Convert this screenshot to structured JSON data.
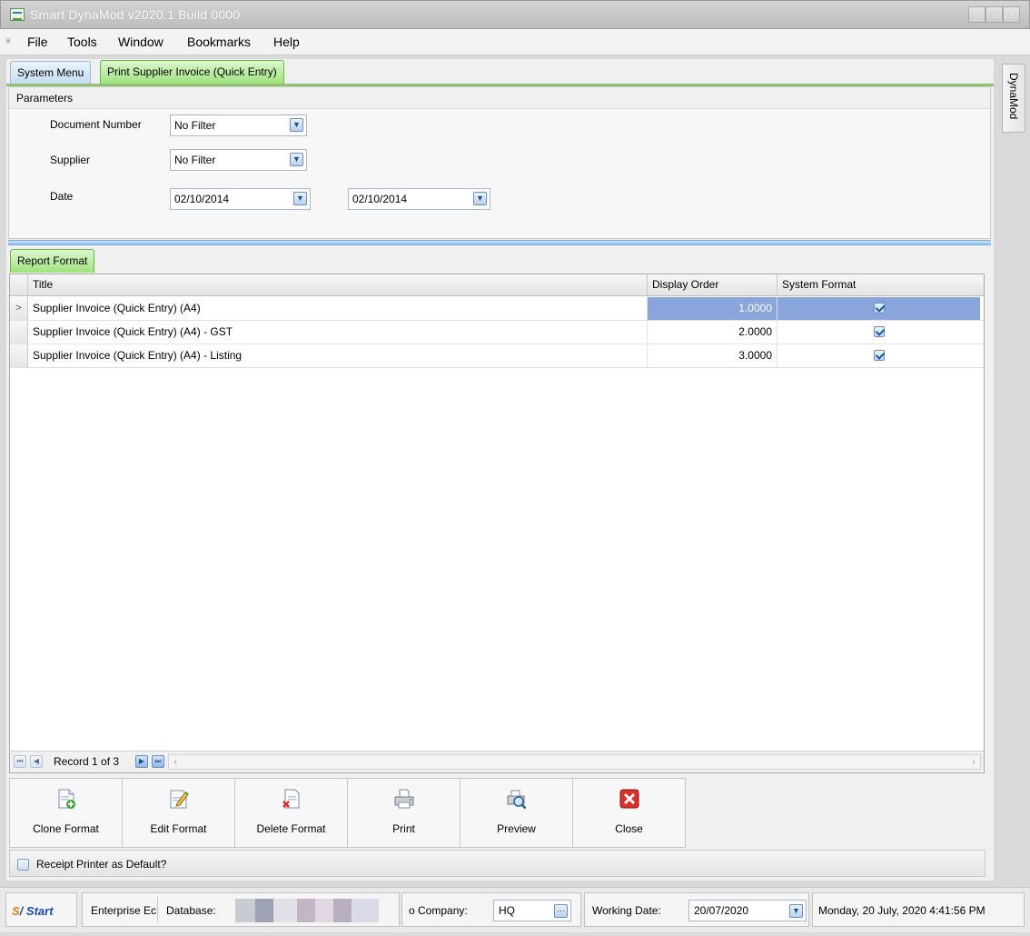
{
  "window": {
    "title": "Smart DynaMod v2020.1 Build 0000",
    "buttons": [
      "_",
      "□",
      "X"
    ]
  },
  "menu": [
    "File",
    "Tools",
    "Window",
    "Bookmarks",
    "Help"
  ],
  "tabs": {
    "system_menu": "System Menu",
    "active": "Print Supplier Invoice (Quick Entry)"
  },
  "parameters": {
    "header": "Parameters",
    "document_number": {
      "label": "Document Number",
      "value": "No Filter"
    },
    "supplier": {
      "label": "Supplier",
      "value": "No Filter"
    },
    "date": {
      "label": "Date",
      "from": "02/10/2014",
      "to": "02/10/2014"
    }
  },
  "report_tab": "Report Format",
  "grid": {
    "columns": [
      "Title",
      "Display Order",
      "System Format"
    ],
    "rows": [
      {
        "title": "Supplier Invoice (Quick Entry) (A4)",
        "order": "1.0000",
        "system": true
      },
      {
        "title": "Supplier Invoice (Quick Entry) (A4) - GST",
        "order": "2.0000",
        "system": true
      },
      {
        "title": "Supplier Invoice (Quick Entry) (A4) - Listing",
        "order": "3.0000",
        "system": true
      }
    ],
    "record_text": "Record 1 of 3"
  },
  "actions": {
    "clone": "Clone Format",
    "edit": "Edit Format",
    "delete": "Delete Format",
    "print": "Print",
    "preview": "Preview",
    "close": "Close"
  },
  "receipt_label": "Receipt Printer as Default?",
  "sidetab": "DynaMod",
  "statusbar": {
    "start": "Start",
    "enterprise": "Enterprise Ec",
    "database_label": "Database:",
    "company_label": "o Company:",
    "company_value": "HQ",
    "working_date_label": "Working Date:",
    "working_date": "20/07/2020",
    "datetime": "Monday, 20 July, 2020 4:41:56 PM"
  },
  "colors": {
    "accent_green": "#9fe27d",
    "selection_blue": "#8aa4dc",
    "close_red": "#d9302a"
  }
}
